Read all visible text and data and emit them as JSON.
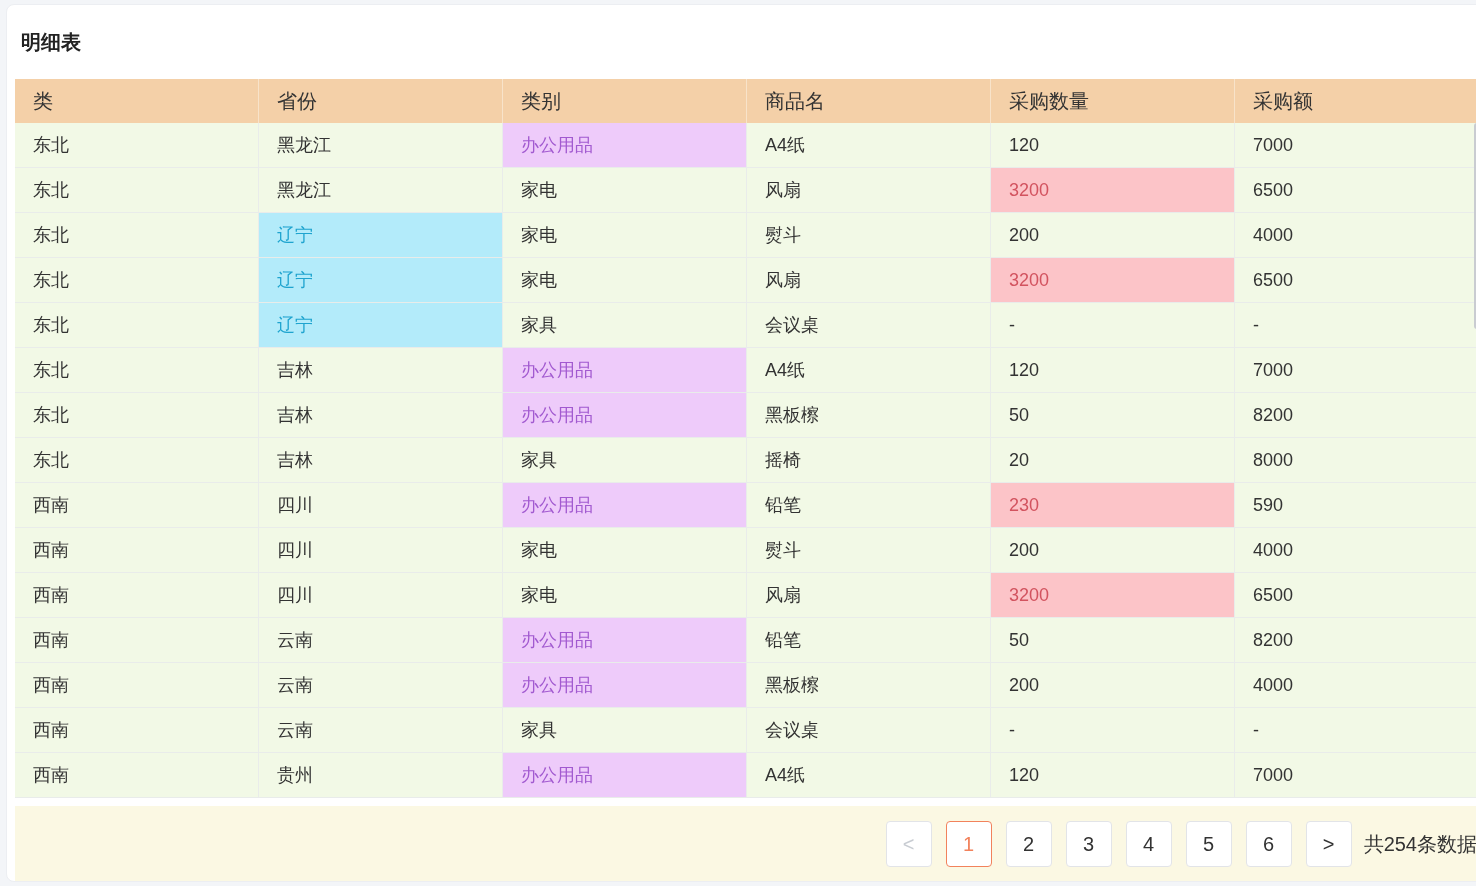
{
  "title": "明细表",
  "table": {
    "columns": [
      "类",
      "省份",
      "类别",
      "商品名",
      "采购数量",
      "采购额"
    ],
    "rows": [
      [
        {
          "text": "东北"
        },
        {
          "text": "黑龙江"
        },
        {
          "text": "办公用品",
          "color": "#eecbfa"
        },
        {
          "text": "A4纸"
        },
        {
          "text": "120"
        },
        {
          "text": "7000"
        }
      ],
      [
        {
          "text": "东北"
        },
        {
          "text": "黑龙江"
        },
        {
          "text": "家电"
        },
        {
          "text": "风扇"
        },
        {
          "text": "3200",
          "color": "#fcc4c8"
        },
        {
          "text": "6500"
        }
      ],
      [
        {
          "text": "东北"
        },
        {
          "text": "辽宁",
          "color": "#b3ebfa"
        },
        {
          "text": "家电"
        },
        {
          "text": "熨斗"
        },
        {
          "text": "200"
        },
        {
          "text": "4000"
        }
      ],
      [
        {
          "text": "东北"
        },
        {
          "text": "辽宁",
          "color": "#b3ebfa"
        },
        {
          "text": "家电"
        },
        {
          "text": "风扇"
        },
        {
          "text": "3200",
          "color": "#fcc4c8"
        },
        {
          "text": "6500"
        }
      ],
      [
        {
          "text": "东北"
        },
        {
          "text": "辽宁",
          "color": "#b3ebfa"
        },
        {
          "text": "家具"
        },
        {
          "text": "会议桌"
        },
        {
          "text": "-"
        },
        {
          "text": "-"
        }
      ],
      [
        {
          "text": "东北"
        },
        {
          "text": "吉林"
        },
        {
          "text": "办公用品",
          "color": "#eecbfa"
        },
        {
          "text": "A4纸"
        },
        {
          "text": "120"
        },
        {
          "text": "7000"
        }
      ],
      [
        {
          "text": "东北"
        },
        {
          "text": "吉林"
        },
        {
          "text": "办公用品",
          "color": "#eecbfa"
        },
        {
          "text": "黑板檫"
        },
        {
          "text": "50"
        },
        {
          "text": "8200"
        }
      ],
      [
        {
          "text": "东北"
        },
        {
          "text": "吉林"
        },
        {
          "text": "家具"
        },
        {
          "text": "摇椅"
        },
        {
          "text": "20"
        },
        {
          "text": "8000"
        }
      ],
      [
        {
          "text": "西南"
        },
        {
          "text": "四川"
        },
        {
          "text": "办公用品",
          "color": "#eecbfa"
        },
        {
          "text": "铅笔"
        },
        {
          "text": "230",
          "color": "#fcc4c8"
        },
        {
          "text": "590"
        }
      ],
      [
        {
          "text": "西南"
        },
        {
          "text": "四川"
        },
        {
          "text": "家电"
        },
        {
          "text": "熨斗"
        },
        {
          "text": "200"
        },
        {
          "text": "4000"
        }
      ],
      [
        {
          "text": "西南"
        },
        {
          "text": "四川"
        },
        {
          "text": "家电"
        },
        {
          "text": "风扇"
        },
        {
          "text": "3200",
          "color": "#fcc4c8"
        },
        {
          "text": "6500"
        }
      ],
      [
        {
          "text": "西南"
        },
        {
          "text": "云南"
        },
        {
          "text": "办公用品",
          "color": "#eecbfa"
        },
        {
          "text": "铅笔"
        },
        {
          "text": "50"
        },
        {
          "text": "8200"
        }
      ],
      [
        {
          "text": "西南"
        },
        {
          "text": "云南"
        },
        {
          "text": "办公用品",
          "color": "#eecbfa"
        },
        {
          "text": "黑板檫"
        },
        {
          "text": "200"
        },
        {
          "text": "4000"
        }
      ],
      [
        {
          "text": "西南"
        },
        {
          "text": "云南"
        },
        {
          "text": "家具"
        },
        {
          "text": "会议桌"
        },
        {
          "text": "-"
        },
        {
          "text": "-"
        }
      ],
      [
        {
          "text": "西南"
        },
        {
          "text": "贵州"
        },
        {
          "text": "办公用品",
          "color": "#eecbfa"
        },
        {
          "text": "A4纸"
        },
        {
          "text": "120"
        },
        {
          "text": "7000"
        }
      ]
    ]
  },
  "pagination": {
    "prev": "<",
    "next": ">",
    "pages": [
      {
        "label": "1",
        "selected": true
      },
      {
        "label": "2",
        "selected": false
      },
      {
        "label": "3",
        "selected": false
      },
      {
        "label": "4",
        "selected": false
      },
      {
        "label": "5",
        "selected": false
      },
      {
        "label": "6",
        "selected": false
      }
    ],
    "total": "共254条数据"
  }
}
